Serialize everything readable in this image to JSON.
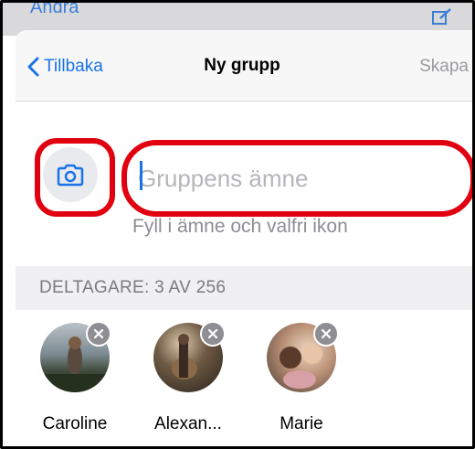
{
  "background": {
    "edit_label": "Ändra",
    "compose_icon": "compose-icon"
  },
  "nav": {
    "back_label": "Tillbaka",
    "title": "Ny grupp",
    "create_label": "Skapa"
  },
  "group": {
    "photo_icon": "camera-icon",
    "subject_placeholder": "Gruppens ämne",
    "hint": "Fyll i ämne och valfri ikon"
  },
  "participants": {
    "header": "DELTAGARE: 3 AV 256",
    "items": [
      {
        "name": "Caroline"
      },
      {
        "name": "Alexan..."
      },
      {
        "name": "Marie"
      }
    ]
  },
  "colors": {
    "accent": "#1a73e8",
    "highlight": "#e1000f",
    "disabled": "#9b9b9f"
  }
}
